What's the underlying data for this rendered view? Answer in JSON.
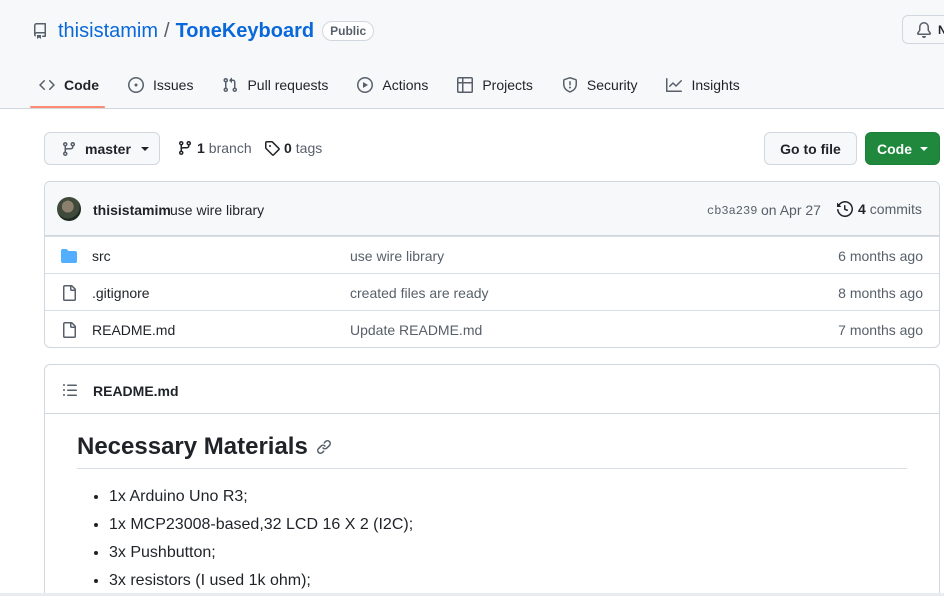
{
  "header": {
    "owner": "thisistamim",
    "separator": "/",
    "repo": "ToneKeyboard",
    "visibility": "Public",
    "notifications_label": "N"
  },
  "nav": {
    "tabs": [
      {
        "label": "Code",
        "icon": "code-icon",
        "active": true
      },
      {
        "label": "Issues",
        "icon": "issue-icon"
      },
      {
        "label": "Pull requests",
        "icon": "pull-request-icon"
      },
      {
        "label": "Actions",
        "icon": "play-icon"
      },
      {
        "label": "Projects",
        "icon": "table-icon"
      },
      {
        "label": "Security",
        "icon": "shield-icon"
      },
      {
        "label": "Insights",
        "icon": "graph-icon"
      }
    ]
  },
  "toolbar": {
    "branch": "master",
    "branch_count": "1",
    "branch_label": "branch",
    "tag_count": "0",
    "tag_label": "tags",
    "goto_file": "Go to file",
    "code_button": "Code"
  },
  "latest_commit": {
    "author": "thisistamim",
    "message": "use wire library",
    "sha": "cb3a239",
    "date": "on Apr 27",
    "commit_count": "4",
    "commit_label": "commits"
  },
  "files": [
    {
      "name": "src",
      "type": "folder",
      "commit": "use wire library",
      "age": "6 months ago"
    },
    {
      "name": ".gitignore",
      "type": "file",
      "commit": "created files are ready",
      "age": "8 months ago"
    },
    {
      "name": "README.md",
      "type": "file",
      "commit": "Update README.md",
      "age": "7 months ago"
    }
  ],
  "readme": {
    "title": "README.md",
    "heading": "Necessary Materials",
    "items": [
      "1x Arduino Uno R3;",
      "1x MCP23008-based,32 LCD 16 X 2 (I2C);",
      "3x Pushbutton;",
      "3x resistors (I used 1k ohm);"
    ]
  },
  "colors": {
    "link": "#0969da",
    "primary_button": "#1f883d",
    "active_tab_underline": "#fd8c73",
    "folder": "#54aeff"
  }
}
